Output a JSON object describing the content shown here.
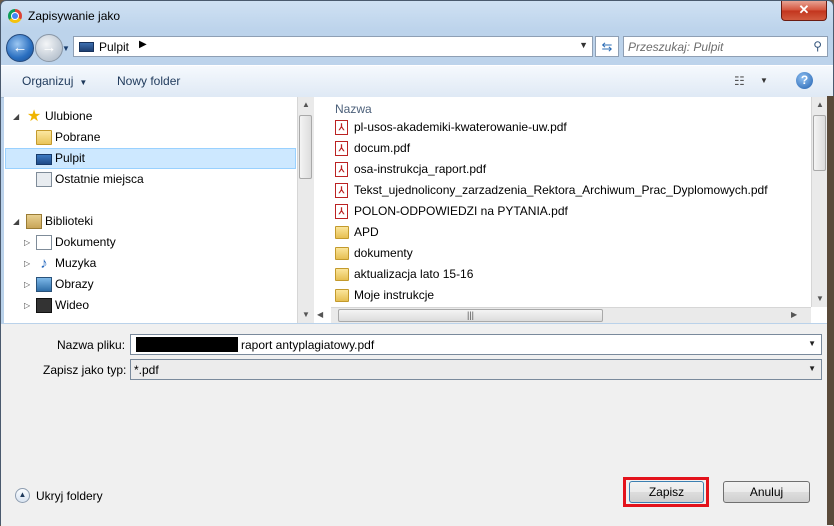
{
  "window": {
    "title": "Zapisywanie jako",
    "close_glyph": "✕"
  },
  "navbar": {
    "address": "Pulpit",
    "search_placeholder": "Przeszukaj: Pulpit"
  },
  "toolbar": {
    "organize": "Organizuj",
    "new_folder": "Nowy folder"
  },
  "tree": {
    "favorites": "Ulubione",
    "items_favorites": [
      "Pobrane",
      "Pulpit",
      "Ostatnie miejsca"
    ],
    "libraries": "Biblioteki",
    "items_libraries": [
      "Dokumenty",
      "Muzyka",
      "Obrazy",
      "Wideo"
    ]
  },
  "files": {
    "column_name": "Nazwa",
    "items": [
      {
        "name": "pl-usos-akademiki-kwaterowanie-uw.pdf",
        "type": "pdf"
      },
      {
        "name": "docum.pdf",
        "type": "pdf"
      },
      {
        "name": "osa-instrukcja_raport.pdf",
        "type": "pdf"
      },
      {
        "name": "Tekst_ujednolicony_zarzadzenia_Rektora_Archiwum_Prac_Dyplomowych.pdf",
        "type": "pdf"
      },
      {
        "name": "POLON-ODPOWIEDZI na PYTANIA.pdf",
        "type": "pdf"
      },
      {
        "name": "APD",
        "type": "folder"
      },
      {
        "name": "dokumenty",
        "type": "folder"
      },
      {
        "name": "aktualizacja lato 15-16",
        "type": "folder"
      },
      {
        "name": "Moje instrukcje",
        "type": "folder"
      }
    ]
  },
  "form": {
    "filename_label": "Nazwa pliku:",
    "filename_value": "raport antyplagiatowy.pdf",
    "filetype_label": "Zapisz jako typ:",
    "filetype_value": "*.pdf"
  },
  "footer": {
    "hide_folders": "Ukryj foldery",
    "save": "Zapisz",
    "cancel": "Anuluj"
  },
  "colors": {
    "highlight": "#e3121b",
    "selection": "#cde8ff"
  }
}
